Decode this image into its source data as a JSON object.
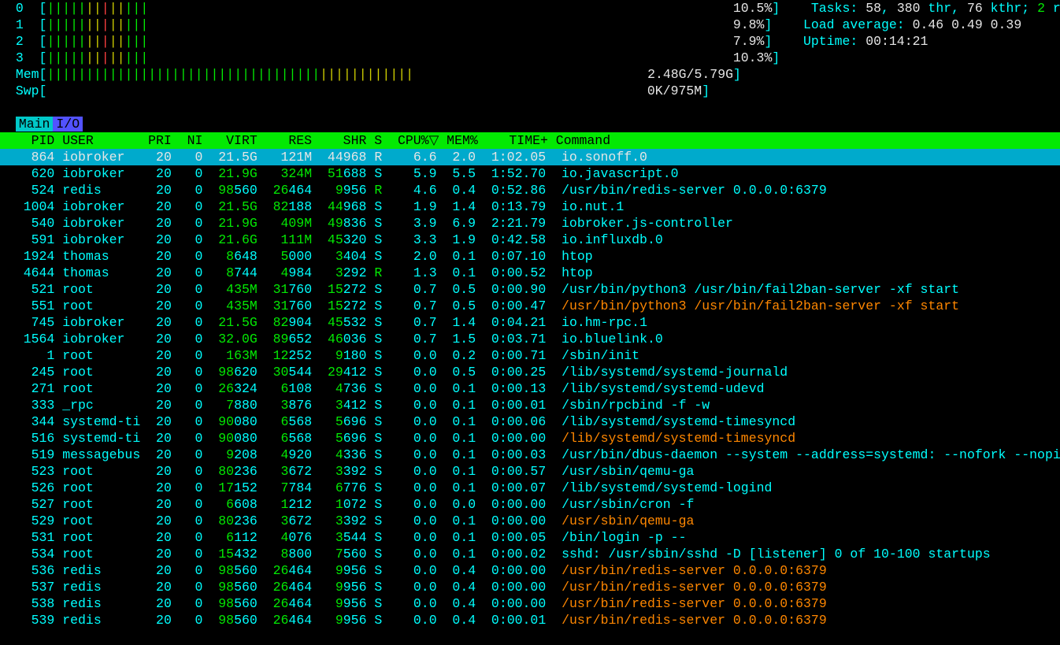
{
  "cpu_meters": [
    {
      "id": "0",
      "pct": "10.5%"
    },
    {
      "id": "1",
      "pct": "9.8%"
    },
    {
      "id": "2",
      "pct": "7.9%"
    },
    {
      "id": "3",
      "pct": "10.3%"
    }
  ],
  "mem": {
    "label": "Mem",
    "used": "2.48G",
    "total": "5.79G"
  },
  "swp": {
    "label": "Swp",
    "used": "0K",
    "total": "975M"
  },
  "summary": {
    "tasks_label": "Tasks: ",
    "tasks": "58",
    "threads": "380",
    "threads_label": " thr",
    "kthreads": "76",
    "kthreads_label": " kthr; ",
    "running": "2",
    "running_label": " running",
    "load_label": "Load average: ",
    "l1": "0.46",
    "l2": "0.49",
    "l3": "0.39",
    "uptime_label": "Uptime: ",
    "uptime": "00:14:21"
  },
  "tabs": {
    "main": "Main",
    "io": "I/O"
  },
  "columns": [
    "PID",
    "USER",
    "PRI",
    "NI",
    "VIRT",
    "RES",
    "SHR",
    "S",
    "CPU%",
    "MEM%",
    "TIME+",
    "Command"
  ],
  "sort_indicator_col": "CPU%",
  "rows": [
    {
      "pid": "864",
      "user": "iobroker",
      "pri": "20",
      "ni": "0",
      "virt": "21.5G",
      "res": "121M",
      "shr": "44968",
      "s": "R",
      "cpu": "6.6",
      "mem": "2.0",
      "time": "1:02.05",
      "cmd": "io.sonoff.0",
      "sel": true,
      "virt_g": true,
      "res_g": false
    },
    {
      "pid": "620",
      "user": "iobroker",
      "pri": "20",
      "ni": "0",
      "virt": "21.9G",
      "res": "324M",
      "shr": "51688",
      "s": "S",
      "cpu": "5.9",
      "mem": "5.5",
      "time": "1:52.70",
      "cmd": "io.javascript.0",
      "virt_g": true,
      "res_m": true,
      "shr_hi": "51"
    },
    {
      "pid": "524",
      "user": "redis",
      "pri": "20",
      "ni": "0",
      "virt": "98560",
      "res": "26464",
      "shr": "9956",
      "s": "R",
      "cpu": "4.6",
      "mem": "0.4",
      "time": "0:52.86",
      "cmd": "/usr/bin/redis-server 0.0.0.0:6379",
      "virt_hi": "98",
      "res_hi": "26",
      "shr_hi": "9"
    },
    {
      "pid": "1004",
      "user": "iobroker",
      "pri": "20",
      "ni": "0",
      "virt": "21.5G",
      "res": "82188",
      "shr": "44968",
      "s": "S",
      "cpu": "1.9",
      "mem": "1.4",
      "time": "0:13.79",
      "cmd": "io.nut.1",
      "virt_g": true,
      "res_hi": "82",
      "shr_hi": "44"
    },
    {
      "pid": "540",
      "user": "iobroker",
      "pri": "20",
      "ni": "0",
      "virt": "21.9G",
      "res": "409M",
      "shr": "49836",
      "s": "S",
      "cpu": "3.9",
      "mem": "6.9",
      "time": "2:21.79",
      "cmd": "iobroker.js-controller",
      "virt_g": true,
      "res_m": true,
      "shr_hi": "49"
    },
    {
      "pid": "591",
      "user": "iobroker",
      "pri": "20",
      "ni": "0",
      "virt": "21.6G",
      "res": "111M",
      "shr": "45320",
      "s": "S",
      "cpu": "3.3",
      "mem": "1.9",
      "time": "0:42.58",
      "cmd": "io.influxdb.0",
      "virt_g": true,
      "res_m": true,
      "shr_hi": "45"
    },
    {
      "pid": "1924",
      "user": "thomas",
      "pri": "20",
      "ni": "0",
      "virt": "8648",
      "res": "5000",
      "shr": "3404",
      "s": "S",
      "cpu": "2.0",
      "mem": "0.1",
      "time": "0:07.10",
      "cmd": "htop",
      "virt_hi": "8",
      "res_hi": "5",
      "shr_hi": "3"
    },
    {
      "pid": "4644",
      "user": "thomas",
      "pri": "20",
      "ni": "0",
      "virt": "8744",
      "res": "4984",
      "shr": "3292",
      "s": "R",
      "cpu": "1.3",
      "mem": "0.1",
      "time": "0:00.52",
      "cmd": "htop",
      "virt_hi": "8",
      "res_hi": "4",
      "shr_hi": "3"
    },
    {
      "pid": "521",
      "user": "root",
      "pri": "20",
      "ni": "0",
      "virt": "435M",
      "res": "31760",
      "shr": "15272",
      "s": "S",
      "cpu": "0.7",
      "mem": "0.5",
      "time": "0:00.90",
      "cmd": "/usr/bin/python3 /usr/bin/fail2ban-server -xf start",
      "virt_m": true,
      "res_hi": "31",
      "shr_hi": "15"
    },
    {
      "pid": "551",
      "user": "root",
      "pri": "20",
      "ni": "0",
      "virt": "435M",
      "res": "31760",
      "shr": "15272",
      "s": "S",
      "cpu": "0.7",
      "mem": "0.5",
      "time": "0:00.47",
      "cmd": "/usr/bin/python3 /usr/bin/fail2ban-server -xf start",
      "virt_m": true,
      "res_hi": "31",
      "shr_hi": "15",
      "cmd_or": true
    },
    {
      "pid": "745",
      "user": "iobroker",
      "pri": "20",
      "ni": "0",
      "virt": "21.5G",
      "res": "82904",
      "shr": "45532",
      "s": "S",
      "cpu": "0.7",
      "mem": "1.4",
      "time": "0:04.21",
      "cmd": "io.hm-rpc.1",
      "virt_g": true,
      "res_hi": "82",
      "shr_hi": "45"
    },
    {
      "pid": "1564",
      "user": "iobroker",
      "pri": "20",
      "ni": "0",
      "virt": "32.0G",
      "res": "89652",
      "shr": "46036",
      "s": "S",
      "cpu": "0.7",
      "mem": "1.5",
      "time": "0:03.71",
      "cmd": "io.bluelink.0",
      "virt_g": true,
      "res_hi": "89",
      "shr_hi": "46"
    },
    {
      "pid": "1",
      "user": "root",
      "pri": "20",
      "ni": "0",
      "virt": "163M",
      "res": "12252",
      "shr": "9180",
      "s": "S",
      "cpu": "0.0",
      "mem": "0.2",
      "time": "0:00.71",
      "cmd": "/sbin/init",
      "virt_m": true,
      "res_hi": "12",
      "shr_hi": "9"
    },
    {
      "pid": "245",
      "user": "root",
      "pri": "20",
      "ni": "0",
      "virt": "98620",
      "res": "30544",
      "shr": "29412",
      "s": "S",
      "cpu": "0.0",
      "mem": "0.5",
      "time": "0:00.25",
      "cmd": "/lib/systemd/systemd-journald",
      "virt_hi": "98",
      "res_hi": "30",
      "shr_hi": "29"
    },
    {
      "pid": "271",
      "user": "root",
      "pri": "20",
      "ni": "0",
      "virt": "26324",
      "res": "6108",
      "shr": "4736",
      "s": "S",
      "cpu": "0.0",
      "mem": "0.1",
      "time": "0:00.13",
      "cmd": "/lib/systemd/systemd-udevd",
      "virt_hi": "26",
      "res_hi": "6",
      "shr_hi": "4"
    },
    {
      "pid": "333",
      "user": "_rpc",
      "pri": "20",
      "ni": "0",
      "virt": "7880",
      "res": "3876",
      "shr": "3412",
      "s": "S",
      "cpu": "0.0",
      "mem": "0.1",
      "time": "0:00.01",
      "cmd": "/sbin/rpcbind -f -w",
      "virt_hi": "7",
      "res_hi": "3",
      "shr_hi": "3"
    },
    {
      "pid": "344",
      "user": "systemd-ti",
      "pri": "20",
      "ni": "0",
      "virt": "90080",
      "res": "6568",
      "shr": "5696",
      "s": "S",
      "cpu": "0.0",
      "mem": "0.1",
      "time": "0:00.06",
      "cmd": "/lib/systemd/systemd-timesyncd",
      "virt_hi": "90",
      "res_hi": "6",
      "shr_hi": "5"
    },
    {
      "pid": "516",
      "user": "systemd-ti",
      "pri": "20",
      "ni": "0",
      "virt": "90080",
      "res": "6568",
      "shr": "5696",
      "s": "S",
      "cpu": "0.0",
      "mem": "0.1",
      "time": "0:00.00",
      "cmd": "/lib/systemd/systemd-timesyncd",
      "virt_hi": "90",
      "res_hi": "6",
      "shr_hi": "5",
      "cmd_or": true
    },
    {
      "pid": "519",
      "user": "messagebus",
      "pri": "20",
      "ni": "0",
      "virt": "9208",
      "res": "4920",
      "shr": "4336",
      "s": "S",
      "cpu": "0.0",
      "mem": "0.1",
      "time": "0:00.03",
      "cmd": "/usr/bin/dbus-daemon --system --address=systemd: --nofork --nopidfi",
      "virt_hi": "9",
      "res_hi": "4",
      "shr_hi": "4"
    },
    {
      "pid": "523",
      "user": "root",
      "pri": "20",
      "ni": "0",
      "virt": "80236",
      "res": "3672",
      "shr": "3392",
      "s": "S",
      "cpu": "0.0",
      "mem": "0.1",
      "time": "0:00.57",
      "cmd": "/usr/sbin/qemu-ga",
      "virt_hi": "80",
      "res_hi": "3",
      "shr_hi": "3"
    },
    {
      "pid": "526",
      "user": "root",
      "pri": "20",
      "ni": "0",
      "virt": "17152",
      "res": "7784",
      "shr": "6776",
      "s": "S",
      "cpu": "0.0",
      "mem": "0.1",
      "time": "0:00.07",
      "cmd": "/lib/systemd/systemd-logind",
      "virt_hi": "17",
      "res_hi": "7",
      "shr_hi": "6"
    },
    {
      "pid": "527",
      "user": "root",
      "pri": "20",
      "ni": "0",
      "virt": "6608",
      "res": "1212",
      "shr": "1072",
      "s": "S",
      "cpu": "0.0",
      "mem": "0.0",
      "time": "0:00.00",
      "cmd": "/usr/sbin/cron -f",
      "virt_hi": "6",
      "res_hi": "1",
      "shr_hi": "1"
    },
    {
      "pid": "529",
      "user": "root",
      "pri": "20",
      "ni": "0",
      "virt": "80236",
      "res": "3672",
      "shr": "3392",
      "s": "S",
      "cpu": "0.0",
      "mem": "0.1",
      "time": "0:00.00",
      "cmd": "/usr/sbin/qemu-ga",
      "virt_hi": "80",
      "res_hi": "3",
      "shr_hi": "3",
      "cmd_or": true
    },
    {
      "pid": "531",
      "user": "root",
      "pri": "20",
      "ni": "0",
      "virt": "6112",
      "res": "4076",
      "shr": "3544",
      "s": "S",
      "cpu": "0.0",
      "mem": "0.1",
      "time": "0:00.05",
      "cmd": "/bin/login -p --",
      "virt_hi": "6",
      "res_hi": "4",
      "shr_hi": "3"
    },
    {
      "pid": "534",
      "user": "root",
      "pri": "20",
      "ni": "0",
      "virt": "15432",
      "res": "8800",
      "shr": "7560",
      "s": "S",
      "cpu": "0.0",
      "mem": "0.1",
      "time": "0:00.02",
      "cmd": "sshd: /usr/sbin/sshd -D [listener] 0 of 10-100 startups",
      "virt_hi": "15",
      "res_hi": "8",
      "shr_hi": "7"
    },
    {
      "pid": "536",
      "user": "redis",
      "pri": "20",
      "ni": "0",
      "virt": "98560",
      "res": "26464",
      "shr": "9956",
      "s": "S",
      "cpu": "0.0",
      "mem": "0.4",
      "time": "0:00.00",
      "cmd": "/usr/bin/redis-server 0.0.0.0:6379",
      "virt_hi": "98",
      "res_hi": "26",
      "shr_hi": "9",
      "cmd_or": true
    },
    {
      "pid": "537",
      "user": "redis",
      "pri": "20",
      "ni": "0",
      "virt": "98560",
      "res": "26464",
      "shr": "9956",
      "s": "S",
      "cpu": "0.0",
      "mem": "0.4",
      "time": "0:00.00",
      "cmd": "/usr/bin/redis-server 0.0.0.0:6379",
      "virt_hi": "98",
      "res_hi": "26",
      "shr_hi": "9",
      "cmd_or": true
    },
    {
      "pid": "538",
      "user": "redis",
      "pri": "20",
      "ni": "0",
      "virt": "98560",
      "res": "26464",
      "shr": "9956",
      "s": "S",
      "cpu": "0.0",
      "mem": "0.4",
      "time": "0:00.00",
      "cmd": "/usr/bin/redis-server 0.0.0.0:6379",
      "virt_hi": "98",
      "res_hi": "26",
      "shr_hi": "9",
      "cmd_or": true
    },
    {
      "pid": "539",
      "user": "redis",
      "pri": "20",
      "ni": "0",
      "virt": "98560",
      "res": "26464",
      "shr": "9956",
      "s": "S",
      "cpu": "0.0",
      "mem": "0.4",
      "time": "0:00.01",
      "cmd": "/usr/bin/redis-server 0.0.0.0:6379",
      "virt_hi": "98",
      "res_hi": "26",
      "shr_hi": "9",
      "cmd_or": true
    }
  ]
}
